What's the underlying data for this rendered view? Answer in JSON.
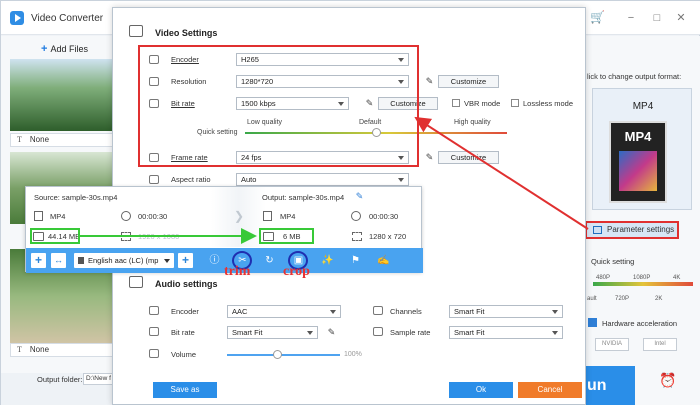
{
  "app": {
    "title": "Video Converter",
    "add_files_label": "Add Files",
    "subtitle_rows": [
      "None",
      "None"
    ],
    "output_folder_label": "Output folder:",
    "output_folder_value": "D:\\New f",
    "run_label": "un"
  },
  "right_panel": {
    "hint": "lick to change output format:",
    "format": "MP4",
    "format_icon_text": "MP4",
    "param_button": "Parameter settings",
    "quick_setting": "Quick setting",
    "quick_top_labels": [
      "480P",
      "1080P",
      "4K"
    ],
    "quick_bottom_labels": [
      "ault",
      "720P",
      "2K"
    ],
    "hardware_accel": "Hardware acceleration",
    "chips": [
      "NVIDIA",
      "Intel"
    ]
  },
  "video_settings": {
    "title": "Video Settings",
    "encoder_label": "Encoder",
    "encoder_value": "H265",
    "resolution_label": "Resolution",
    "resolution_value": "1280*720",
    "customize_label": "Customize",
    "bitrate_label": "Bit rate",
    "bitrate_value": "1500 kbps",
    "vbr_label": "VBR mode",
    "lossless_label": "Lossless mode",
    "quick_setting_label": "Quick setting",
    "quality_low": "Low quality",
    "quality_default": "Default",
    "quality_high": "High quality",
    "quality_level": 0.5,
    "framerate_label": "Frame rate",
    "framerate_value": "24 fps",
    "aspect_label": "Aspect ratio",
    "aspect_value": "Auto"
  },
  "file_card": {
    "source_label": "Source: sample-30s.mp4",
    "output_label": "Output: sample-30s.mp4",
    "src_format": "MP4",
    "src_duration": "00:00:30",
    "src_size": "44.14 MB",
    "src_resolution": "1920 x 1080",
    "out_format": "MP4",
    "out_duration": "00:00:30",
    "out_size": "6 MB",
    "out_resolution": "1280 x 720",
    "audio_track": "English aac (LC) (mp"
  },
  "annotations": {
    "trim": "trim",
    "crop": "crop"
  },
  "audio_settings": {
    "title": "Audio settings",
    "encoder_label": "Encoder",
    "encoder_value": "AAC",
    "channels_label": "Channels",
    "channels_value": "Smart Fit",
    "bitrate_label": "Bit rate",
    "bitrate_value": "Smart Fit",
    "samplerate_label": "Sample rate",
    "samplerate_value": "Smart Fit",
    "volume_label": "Volume",
    "volume_value": "100%",
    "volume_level": 0.45
  },
  "dialog_buttons": {
    "save_as": "Save as",
    "ok": "Ok",
    "cancel": "Cancel"
  },
  "colors": {
    "highlight_red": "#e03030",
    "highlight_green": "#38c938",
    "toolbar_blue": "#49a3f0",
    "ok_blue": "#2a8ee8",
    "cancel_orange": "#f07b2a"
  }
}
